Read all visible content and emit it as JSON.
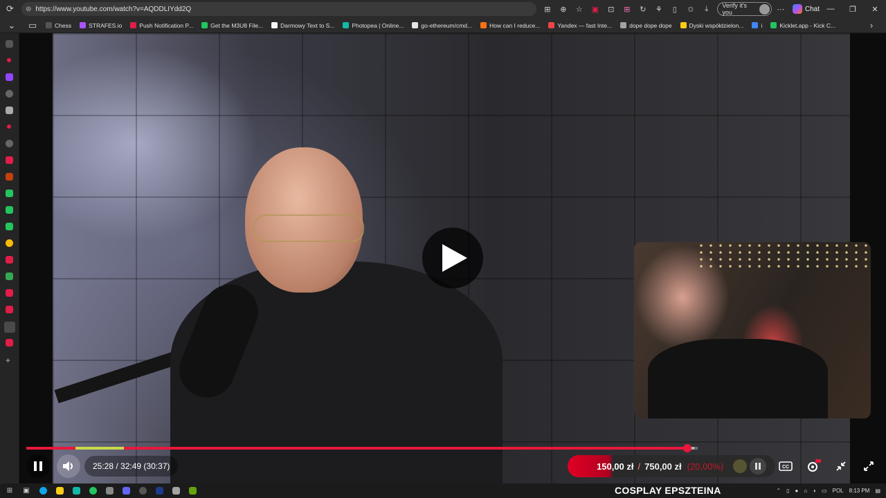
{
  "browser": {
    "url": "https://www.youtube.com/watch?v=AQDDLIYdd2Q",
    "verify_label": "Verify it's you",
    "chat_label": "Chat"
  },
  "bookmarks": [
    {
      "label": "Chess",
      "color": "#555555"
    },
    {
      "label": "STRAFES.io",
      "color": "#a855f7"
    },
    {
      "label": "Push Notification P...",
      "color": "#e11d48"
    },
    {
      "label": "Get the M3U8 File...",
      "color": "#22c55e"
    },
    {
      "label": "Darmowy Text to S...",
      "color": "#f5f5f5"
    },
    {
      "label": "Photopea | Online...",
      "color": "#14b8a6"
    },
    {
      "label": "go-ethereum/cmd...",
      "color": "#e5e5e5"
    },
    {
      "label": "How can I reduce...",
      "color": "#f97316"
    },
    {
      "label": "Yandex — fast Inte...",
      "color": "#ef4444"
    },
    {
      "label": "dope dope dope",
      "color": "#a3a3a3"
    },
    {
      "label": "Dyski współdzielon...",
      "color": "#facc15"
    },
    {
      "label": "i",
      "color": "#4285f4"
    },
    {
      "label": "Kicklet.app - Kick C...",
      "color": "#22c55e"
    }
  ],
  "player": {
    "time_text": "25:28 / 32:49 (30:37)",
    "progress": {
      "played": 0.985,
      "buffered": 0.995,
      "segment_start": 0.073,
      "segment_end": 0.145
    }
  },
  "donation": {
    "current": "150,00 zł",
    "separator": "/",
    "goal": "750,00 zł",
    "percent": "(20,00%)"
  },
  "taskbar": {
    "ticker_text": "COSPLAY EPSZTEINA",
    "lang": "POL",
    "clock": "8:13 PM"
  },
  "colors": {
    "accent": "#e8183a",
    "donation": "#e00024"
  }
}
